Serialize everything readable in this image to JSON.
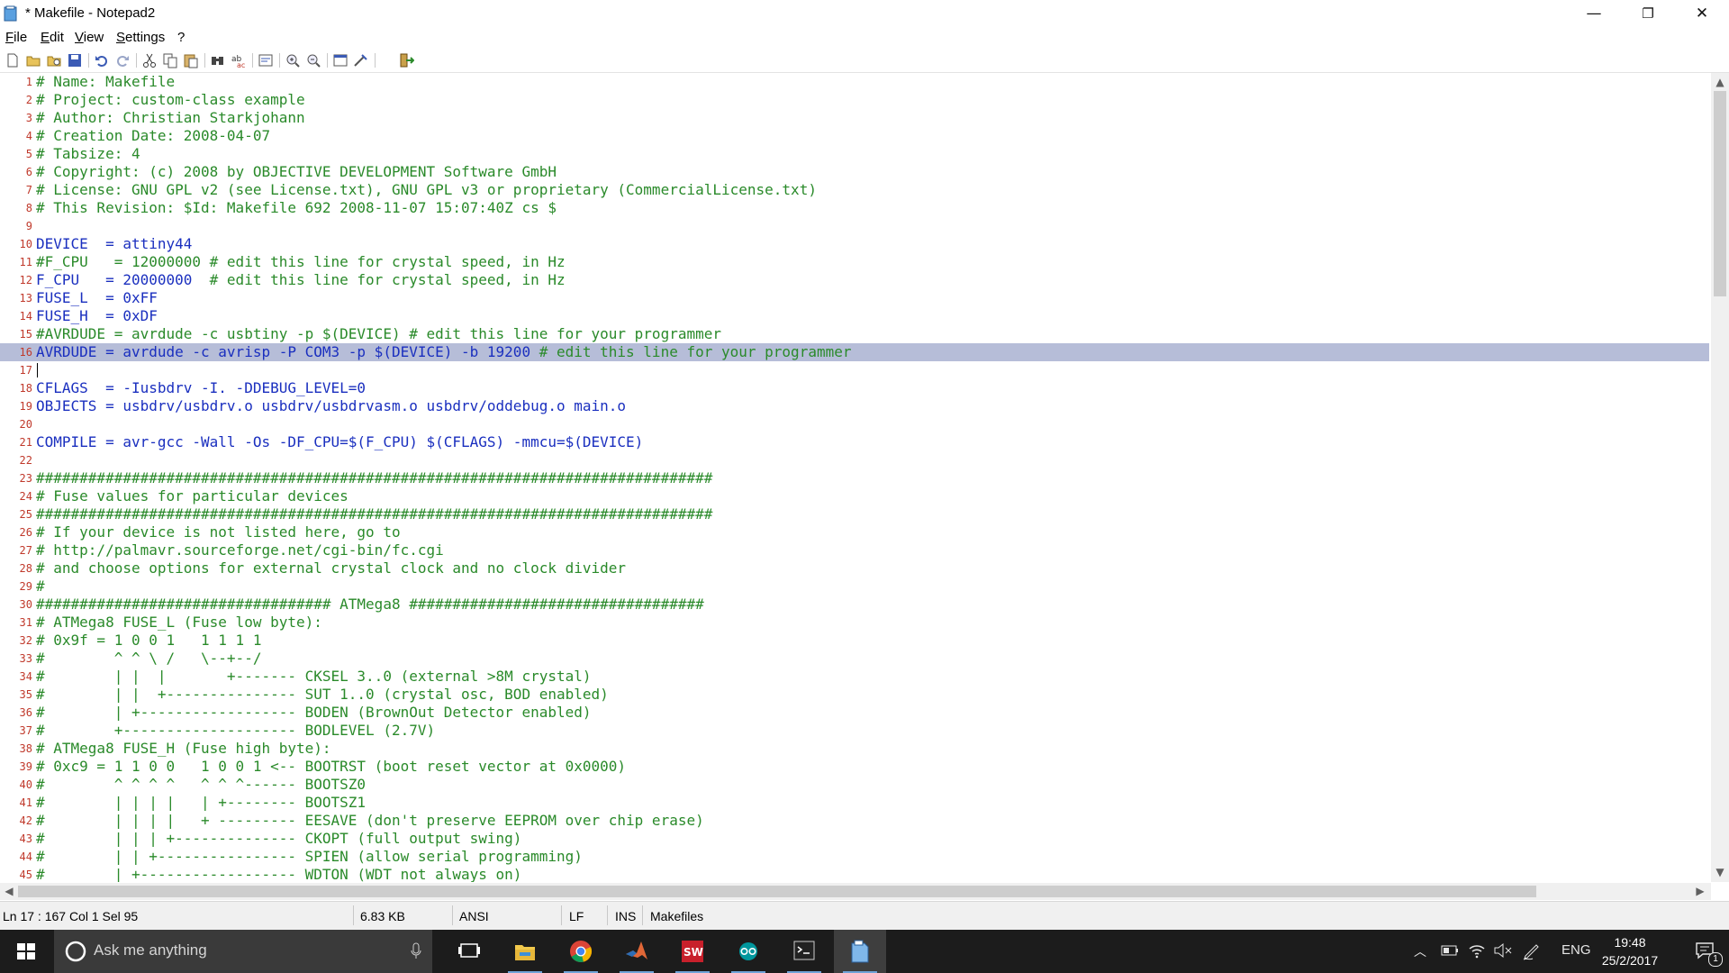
{
  "window": {
    "title": "* Makefile - Notepad2",
    "minimize": "—",
    "restore": "❐",
    "close": "✕"
  },
  "menu": [
    "File",
    "Edit",
    "View",
    "Settings",
    "?"
  ],
  "toolbar_icons": [
    "new-icon",
    "open-icon",
    "browse-icon",
    "save-icon",
    "undo-icon",
    "redo-icon",
    "cut-icon",
    "copy-icon",
    "paste-icon",
    "find-icon",
    "replace-icon",
    "word-wrap-icon",
    "zoom-in-icon",
    "zoom-out-icon",
    "scheme-icon",
    "customize-icon",
    "exit-icon"
  ],
  "editor": {
    "selected_line": 16,
    "caret_line": 17,
    "lines": [
      {
        "n": "1",
        "t": "# Name: Makefile",
        "k": "comment"
      },
      {
        "n": "2",
        "t": "# Project: custom-class example",
        "k": "comment"
      },
      {
        "n": "3",
        "t": "# Author: Christian Starkjohann",
        "k": "comment"
      },
      {
        "n": "4",
        "t": "# Creation Date: 2008-04-07",
        "k": "comment"
      },
      {
        "n": "5",
        "t": "# Tabsize: 4",
        "k": "comment"
      },
      {
        "n": "6",
        "t": "# Copyright: (c) 2008 by OBJECTIVE DEVELOPMENT Software GmbH",
        "k": "comment"
      },
      {
        "n": "7",
        "t": "# License: GNU GPL v2 (see License.txt), GNU GPL v3 or proprietary (CommercialLicense.txt)",
        "k": "comment"
      },
      {
        "n": "8",
        "t": "# This Revision: $Id: Makefile 692 2008-11-07 15:07:40Z cs $",
        "k": "comment"
      },
      {
        "n": "9",
        "t": "",
        "k": "code"
      },
      {
        "n": "10",
        "t": "DEVICE  = attiny44",
        "k": "code"
      },
      {
        "n": "11",
        "t": "#F_CPU   = 12000000 # edit this line for crystal speed, in Hz",
        "k": "comment"
      },
      {
        "n": "12",
        "t": "F_CPU   = 20000000  # edit this line for crystal speed, in Hz",
        "k": "mixed",
        "code": "F_CPU   = 20000000  ",
        "comment": "# edit this line for crystal speed, in Hz"
      },
      {
        "n": "13",
        "t": "FUSE_L  = 0xFF",
        "k": "code"
      },
      {
        "n": "14",
        "t": "FUSE_H  = 0xDF",
        "k": "code"
      },
      {
        "n": "15",
        "t": "#AVRDUDE = avrdude -c usbtiny -p $(DEVICE) # edit this line for your programmer",
        "k": "comment"
      },
      {
        "n": "16",
        "t": "AVRDUDE = avrdude -c avrisp -P COM3 -p $(DEVICE) -b 19200 # edit this line for your programmer",
        "k": "mixed",
        "code": "AVRDUDE = avrdude -c avrisp -P COM3 -p $(DEVICE) -b 19200 ",
        "comment": "# edit this line for your programmer"
      },
      {
        "n": "17",
        "t": "",
        "k": "code"
      },
      {
        "n": "18",
        "t": "CFLAGS  = -Iusbdrv -I. -DDEBUG_LEVEL=0",
        "k": "code"
      },
      {
        "n": "19",
        "t": "OBJECTS = usbdrv/usbdrv.o usbdrv/usbdrvasm.o usbdrv/oddebug.o main.o",
        "k": "code"
      },
      {
        "n": "20",
        "t": "",
        "k": "code"
      },
      {
        "n": "21",
        "t": "COMPILE = avr-gcc -Wall -Os -DF_CPU=$(F_CPU) $(CFLAGS) -mmcu=$(DEVICE)",
        "k": "code"
      },
      {
        "n": "22",
        "t": "",
        "k": "code"
      },
      {
        "n": "23",
        "t": "##############################################################################",
        "k": "comment"
      },
      {
        "n": "24",
        "t": "# Fuse values for particular devices",
        "k": "comment"
      },
      {
        "n": "25",
        "t": "##############################################################################",
        "k": "comment"
      },
      {
        "n": "26",
        "t": "# If your device is not listed here, go to",
        "k": "comment"
      },
      {
        "n": "27",
        "t": "# http://palmavr.sourceforge.net/cgi-bin/fc.cgi",
        "k": "comment"
      },
      {
        "n": "28",
        "t": "# and choose options for external crystal clock and no clock divider",
        "k": "comment"
      },
      {
        "n": "29",
        "t": "#",
        "k": "comment"
      },
      {
        "n": "30",
        "t": "################################## ATMega8 ##################################",
        "k": "comment"
      },
      {
        "n": "31",
        "t": "# ATMega8 FUSE_L (Fuse low byte):",
        "k": "comment"
      },
      {
        "n": "32",
        "t": "# 0x9f = 1 0 0 1   1 1 1 1",
        "k": "comment"
      },
      {
        "n": "33",
        "t": "#        ^ ^ \\ /   \\--+--/",
        "k": "comment"
      },
      {
        "n": "34",
        "t": "#        | |  |       +------- CKSEL 3..0 (external >8M crystal)",
        "k": "comment"
      },
      {
        "n": "35",
        "t": "#        | |  +--------------- SUT 1..0 (crystal osc, BOD enabled)",
        "k": "comment"
      },
      {
        "n": "36",
        "t": "#        | +------------------ BODEN (BrownOut Detector enabled)",
        "k": "comment"
      },
      {
        "n": "37",
        "t": "#        +-------------------- BODLEVEL (2.7V)",
        "k": "comment"
      },
      {
        "n": "38",
        "t": "# ATMega8 FUSE_H (Fuse high byte):",
        "k": "comment"
      },
      {
        "n": "39",
        "t": "# 0xc9 = 1 1 0 0   1 0 0 1 <-- BOOTRST (boot reset vector at 0x0000)",
        "k": "comment"
      },
      {
        "n": "40",
        "t": "#        ^ ^ ^ ^   ^ ^ ^------ BOOTSZ0",
        "k": "comment"
      },
      {
        "n": "41",
        "t": "#        | | | |   | +-------- BOOTSZ1",
        "k": "comment"
      },
      {
        "n": "42",
        "t": "#        | | | |   + --------- EESAVE (don't preserve EEPROM over chip erase)",
        "k": "comment"
      },
      {
        "n": "43",
        "t": "#        | | | +-------------- CKOPT (full output swing)",
        "k": "comment"
      },
      {
        "n": "44",
        "t": "#        | | +---------------- SPIEN (allow serial programming)",
        "k": "comment"
      },
      {
        "n": "45",
        "t": "#        | +------------------ WDTON (WDT not always on)",
        "k": "comment"
      }
    ]
  },
  "status": {
    "position": "Ln 17 : 167   Col 1   Sel 95",
    "size": "6.83 KB",
    "encoding": "ANSI",
    "eol": "LF",
    "mode": "INS",
    "scheme": "Makefiles"
  },
  "taskbar": {
    "search_placeholder": "Ask me anything",
    "apps": [
      "task-view-icon",
      "file-explorer-icon",
      "chrome-icon",
      "matlab-icon",
      "solidworks-icon",
      "arduino-icon",
      "terminal-icon",
      "notepad2-icon"
    ],
    "language": "ENG",
    "time": "19:48",
    "date": "25/2/2017",
    "notification_count": "1"
  },
  "colors": {
    "comment": "#2a8a2a",
    "code": "#1a2fbf",
    "line_number": "#c0392b",
    "selection": "#b6bdd8",
    "taskbar": "#1c1c1c"
  }
}
